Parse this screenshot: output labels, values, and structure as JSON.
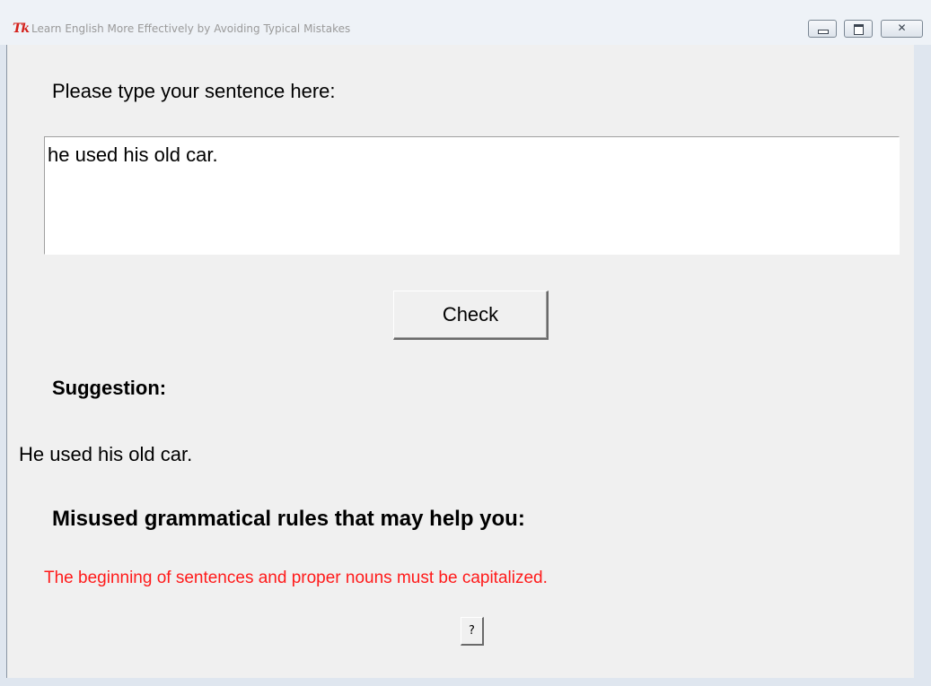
{
  "window": {
    "title": "Learn English More Effectively by Avoiding Typical Mistakes",
    "app_icon": "tk-feather-icon",
    "controls": {
      "minimize": "minimize-icon",
      "maximize": "maximize-icon",
      "close": "close-icon"
    }
  },
  "input": {
    "prompt_label": "Please type your sentence here:",
    "value": "he used his old car."
  },
  "check_button": {
    "label": "Check"
  },
  "suggestion": {
    "heading": "Suggestion:",
    "text": "He used his old car."
  },
  "rules": {
    "heading": "Misused grammatical rules that may help you:",
    "items": [
      "The beginning of sentences and proper nouns must be capitalized."
    ],
    "item_color": "#ff1a1a"
  },
  "help_button": {
    "label": "?"
  }
}
